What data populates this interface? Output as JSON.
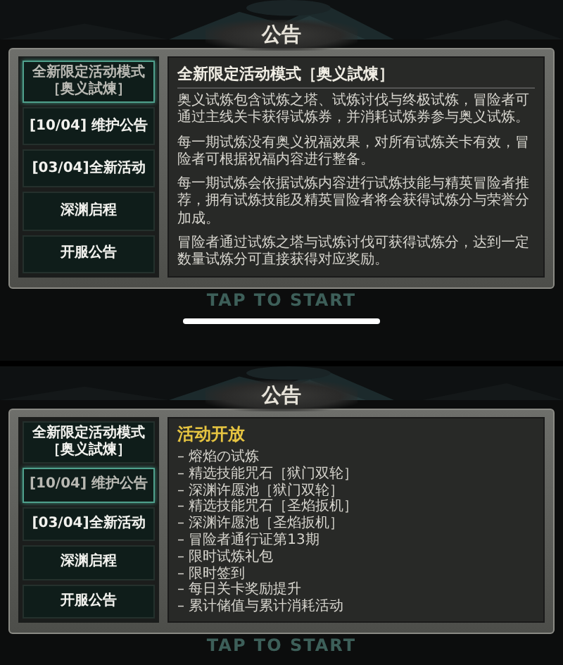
{
  "screens": [
    {
      "title": "公告",
      "tap_hint": "TAP TO START",
      "home_indicator": true,
      "sidebar": [
        {
          "label": "全新限定活动模式［奥义試煉］",
          "selected": true
        },
        {
          "label": "[10/04] 维护公告",
          "selected": false
        },
        {
          "label": "[03/04]全新活动",
          "selected": false
        },
        {
          "label": "深渊启程",
          "selected": false
        },
        {
          "label": "开服公告",
          "selected": false
        }
      ],
      "content": {
        "kind": "article",
        "heading": "全新限定活动模式［奥义試煉］",
        "paragraphs": [
          "奥义试炼包含试炼之塔、试炼讨伐与终极试炼，冒险者可通过主线关卡获得试炼券，并消耗试炼券参与奥义试炼。",
          "每一期试炼没有奥义祝福效果，对所有试炼关卡有效，冒险者可根据祝福内容进行整备。",
          "每一期试炼会依据试炼内容进行试炼技能与精英冒险者推荐，拥有试炼技能及精英冒险者将会获得试炼分与荣誉分加成。",
          "冒险者通过试炼之塔与试炼讨伐可获得试炼分，达到一定数量试炼分可直接获得对应奖励。"
        ]
      }
    },
    {
      "title": "公告",
      "tap_hint": "TAP TO START",
      "sidebar": [
        {
          "label": "全新限定活动模式［奥义試煉］",
          "selected": false
        },
        {
          "label": "[10/04] 维护公告",
          "selected": true
        },
        {
          "label": "[03/04]全新活动",
          "selected": false
        },
        {
          "label": "深渊启程",
          "selected": false
        },
        {
          "label": "开服公告",
          "selected": false
        }
      ],
      "content": {
        "kind": "list",
        "heading": "活动开放",
        "items": [
          "– 熔焰の试炼",
          "– 精选技能咒石［狱门双轮］",
          "– 深渊许愿池［狱门双轮］",
          "– 精选技能咒石［圣焰扳机］",
          "– 深渊许愿池［圣焰扳机］",
          "– 冒险者通行证第13期",
          "– 限时试炼礼包",
          "– 限时签到",
          "– 每日关卡奖励提升",
          "– 累计储值与累计消耗活动"
        ]
      }
    }
  ]
}
